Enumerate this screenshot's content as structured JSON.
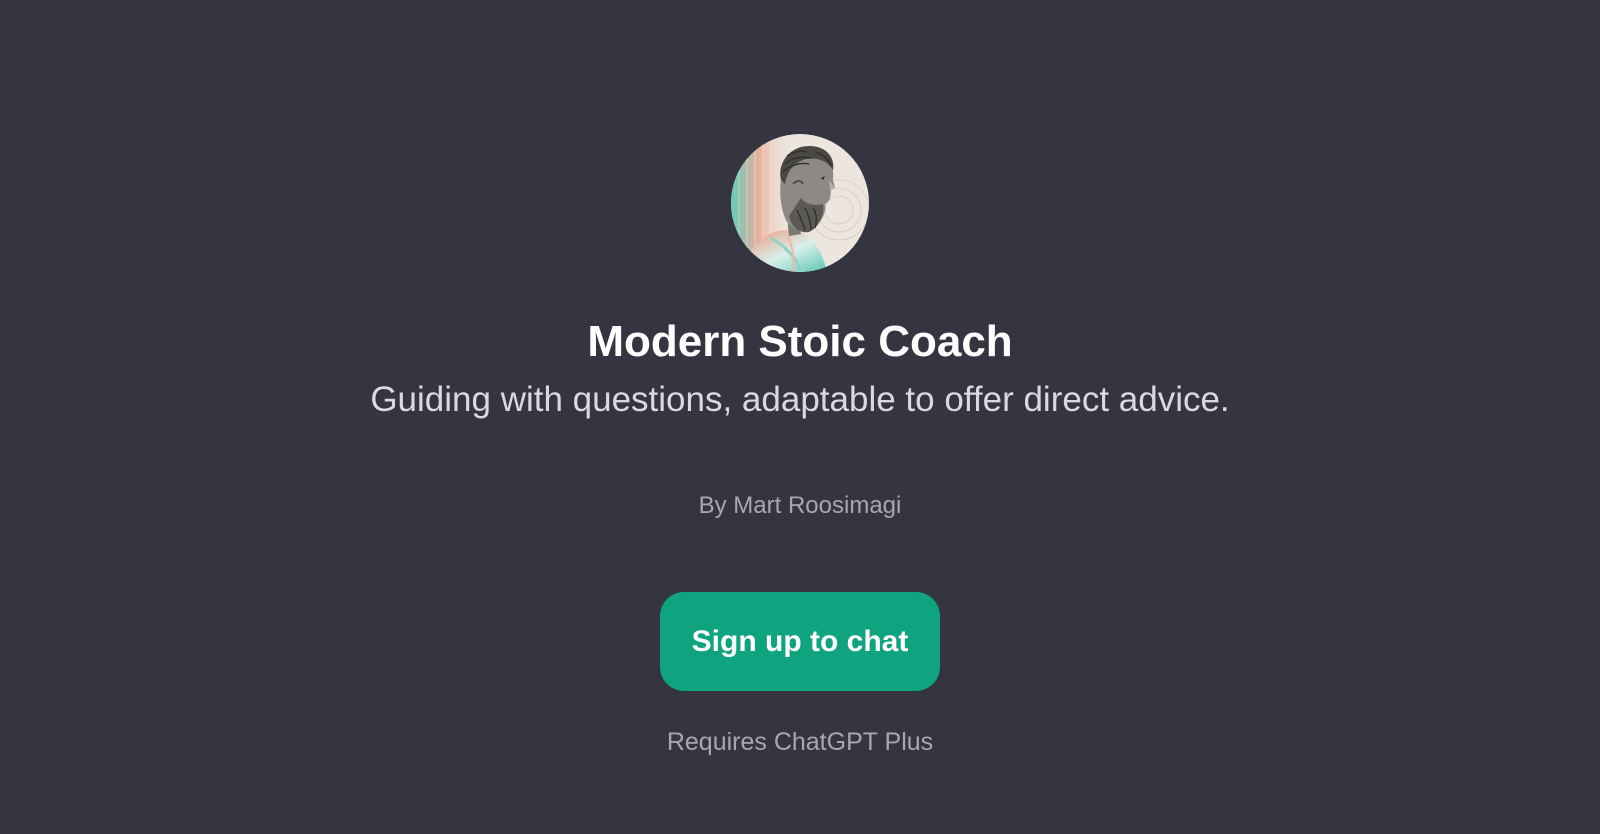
{
  "gpt": {
    "name": "Modern Stoic Coach",
    "description": "Guiding with questions, adaptable to offer direct advice.",
    "author": "By Mart Roosimagi",
    "avatar_icon": "stoic-philosopher-portrait"
  },
  "actions": {
    "signup_label": "Sign up to chat"
  },
  "footer": {
    "requirement": "Requires ChatGPT Plus"
  },
  "colors": {
    "background": "#343541",
    "accent": "#10a37f",
    "title_text": "#ffffff",
    "subtitle_text": "#d9d9e3",
    "muted_text": "#a7a7b2"
  }
}
